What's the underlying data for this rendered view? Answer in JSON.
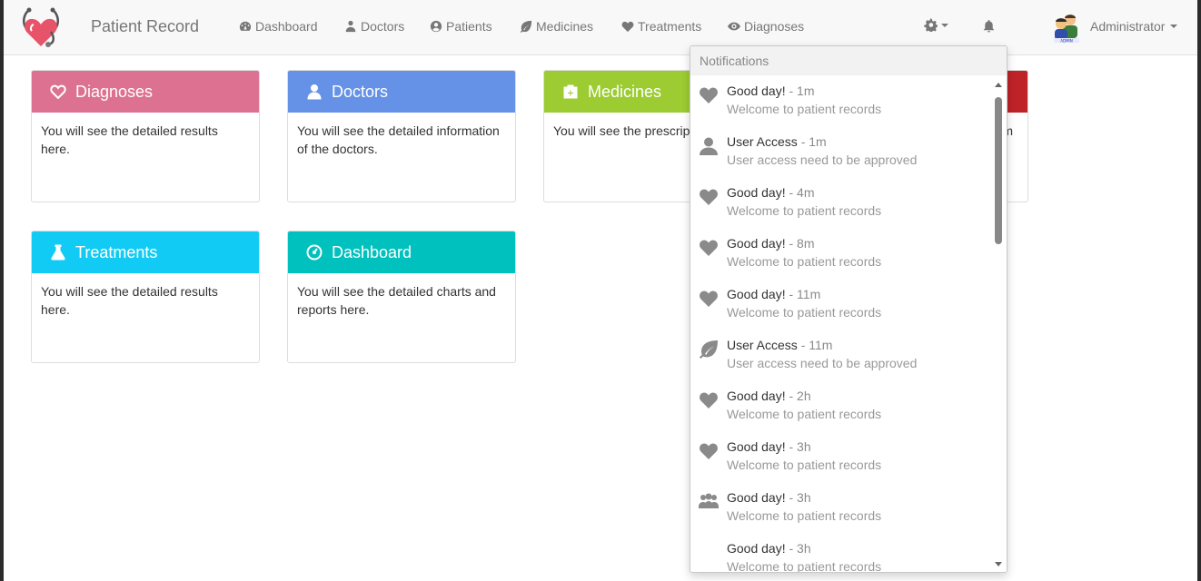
{
  "app": {
    "brand": "Patient Record"
  },
  "nav": {
    "items": [
      {
        "label": "Dashboard",
        "icon": "dashboard-icon"
      },
      {
        "label": "Doctors",
        "icon": "doctor-icon"
      },
      {
        "label": "Patients",
        "icon": "user-circle-icon"
      },
      {
        "label": "Medicines",
        "icon": "leaf-icon"
      },
      {
        "label": "Treatments",
        "icon": "heart-icon"
      },
      {
        "label": "Diagnoses",
        "icon": "eye-icon"
      }
    ],
    "user": "Administrator"
  },
  "cards": [
    {
      "title": "Diagnoses",
      "body": "You will see the detailed results here.",
      "color": "#dd7191",
      "icon": "heart-outline-icon"
    },
    {
      "title": "Doctors",
      "body": "You will see the detailed information of the doctors.",
      "color": "#6592e6",
      "icon": "doctor-icon"
    },
    {
      "title": "Medicines",
      "body": "You will see the prescrip by doctors.",
      "color": "#9ccc32",
      "icon": "medkit-icon"
    },
    {
      "title": "",
      "body": "m",
      "color": "#be2328",
      "icon": ""
    },
    {
      "title": "Treatments",
      "body": "You will see the detailed results here.",
      "color": "#12cbf4",
      "icon": "flask-icon"
    },
    {
      "title": "Dashboard",
      "body": "You will see the detailed charts and reports here.",
      "color": "#00c1bd",
      "icon": "dashboard-icon"
    }
  ],
  "notifications": {
    "header": "Notifications",
    "items": [
      {
        "title": "Good day!",
        "time": "- 1m",
        "message": "Welcome to patient records",
        "icon": "heart-icon"
      },
      {
        "title": "User Access",
        "time": "- 1m",
        "message": "User access need to be approved",
        "icon": "user-icon"
      },
      {
        "title": "Good day!",
        "time": "- 4m",
        "message": "Welcome to patient records",
        "icon": "heart-icon"
      },
      {
        "title": "Good day!",
        "time": "- 8m",
        "message": "Welcome to patient records",
        "icon": "heart-icon"
      },
      {
        "title": "Good day!",
        "time": "- 11m",
        "message": "Welcome to patient records",
        "icon": "heart-icon"
      },
      {
        "title": "User Access",
        "time": "- 11m",
        "message": "User access need to be approved",
        "icon": "leaf-icon"
      },
      {
        "title": "Good day!",
        "time": "- 2h",
        "message": "Welcome to patient records",
        "icon": "heart-icon"
      },
      {
        "title": "Good day!",
        "time": "- 3h",
        "message": "Welcome to patient records",
        "icon": "heart-icon"
      },
      {
        "title": "Good day!",
        "time": "- 3h",
        "message": "Welcome to patient records",
        "icon": "users-icon"
      },
      {
        "title": "Good day!",
        "time": "- 3h",
        "message": "Welcome to patient records",
        "icon": ""
      }
    ]
  }
}
